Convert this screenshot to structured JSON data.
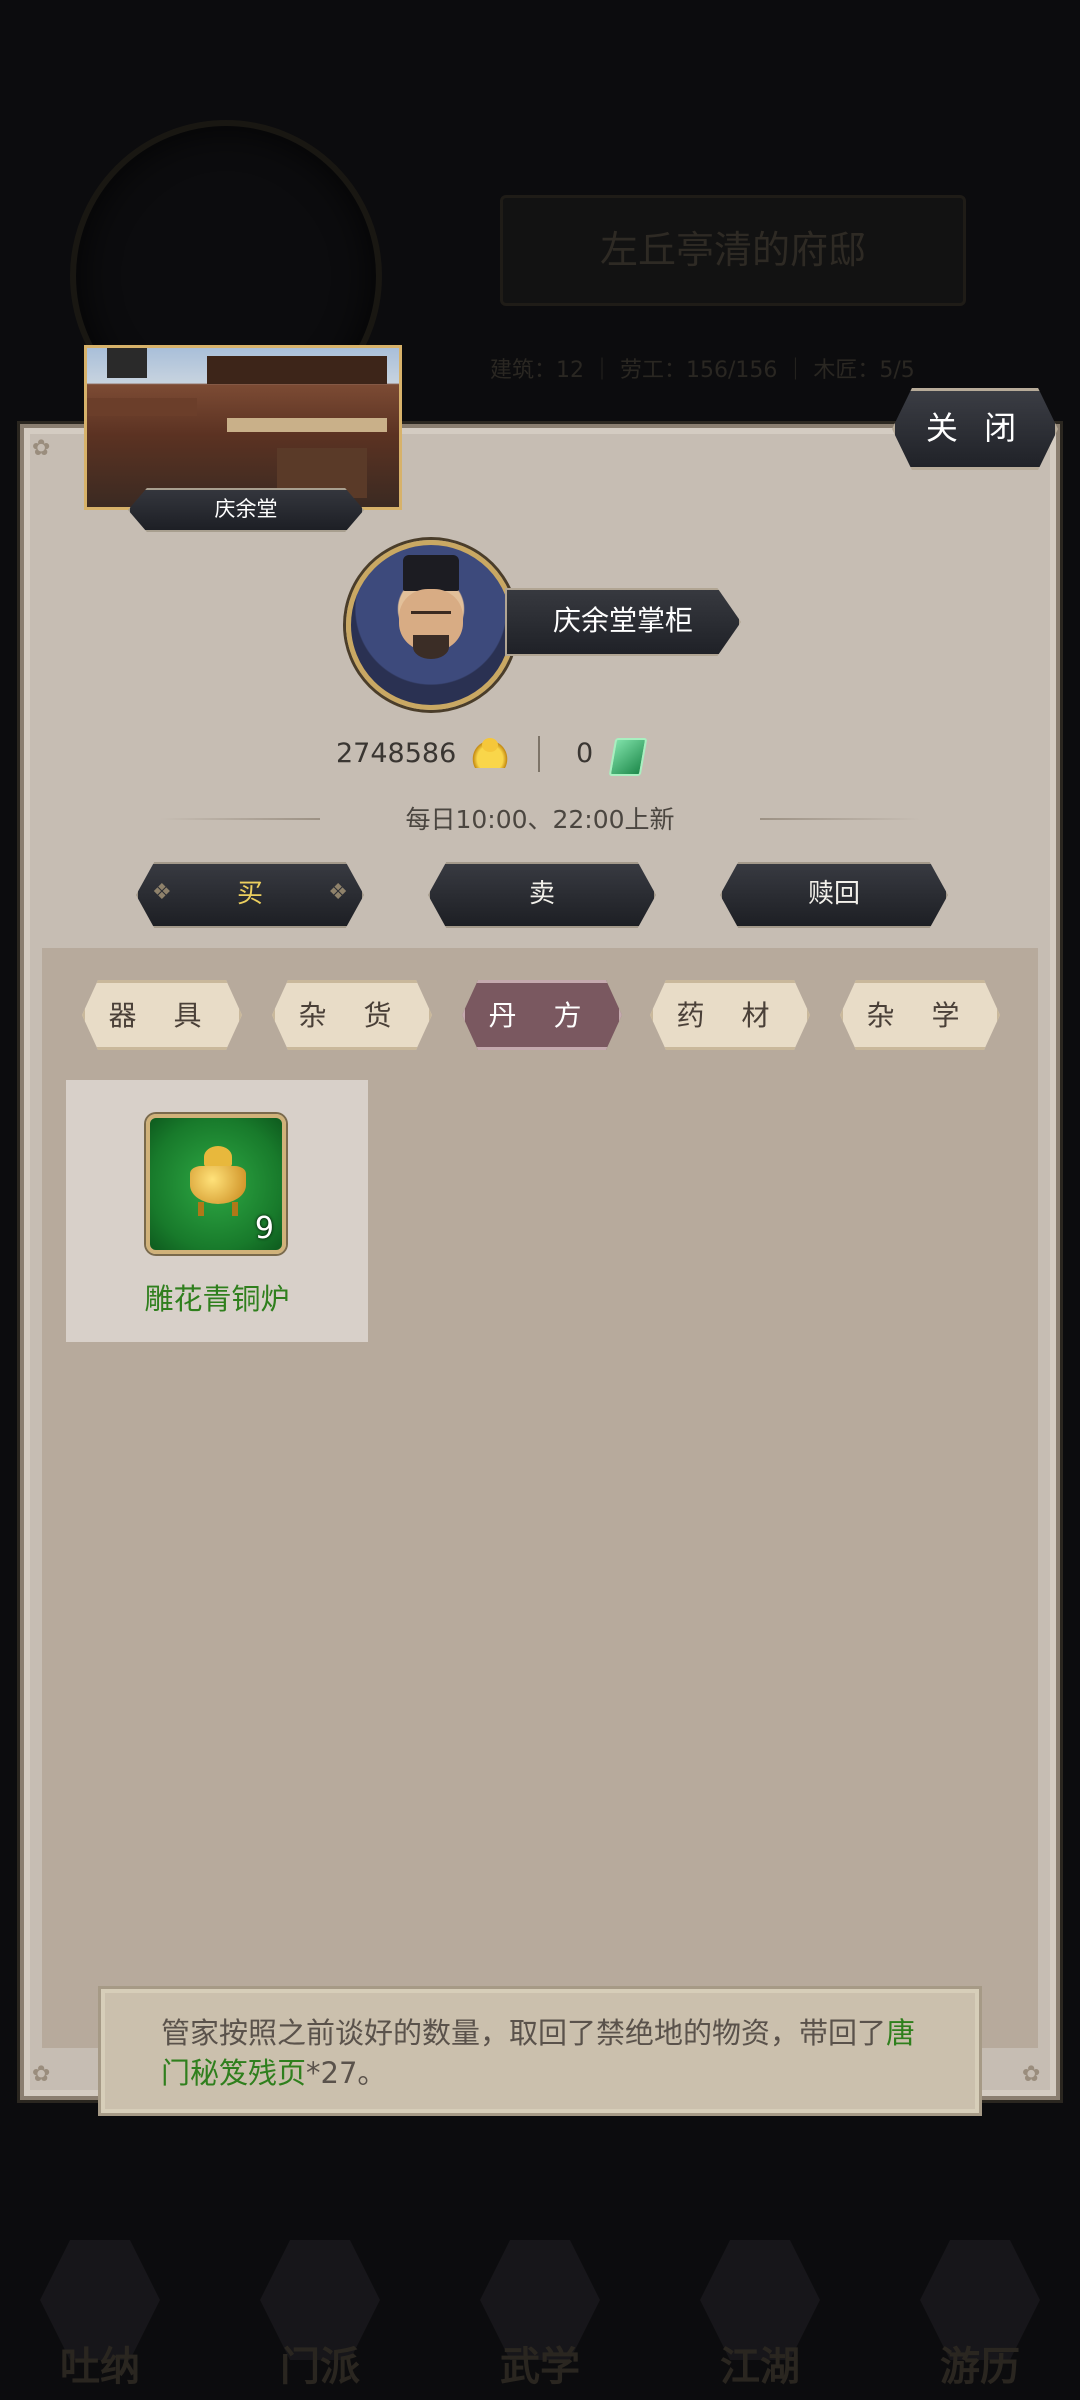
{
  "background": {
    "mansion_title": "左丘亭清的府邸",
    "stats": "建筑：12 ｜ 劳工：156/156 ｜ 木匠：5/5"
  },
  "modal": {
    "close_label": "关 闭",
    "shop_name": "庆余堂",
    "owner_title": "庆余堂掌柜",
    "gold_amount": "2748586",
    "gold_icon": "gold-ingot-icon",
    "jade_amount": "0",
    "jade_icon": "jade-token-icon",
    "refresh_note": "每日10:00、22:00上新",
    "actions": {
      "buy": "买",
      "sell": "卖",
      "redeem": "赎回",
      "active": "buy"
    },
    "categories": [
      {
        "label": "器 具",
        "active": false
      },
      {
        "label": "杂 货",
        "active": false
      },
      {
        "label": "丹 方",
        "active": true
      },
      {
        "label": "药 材",
        "active": false
      },
      {
        "label": "杂 学",
        "active": false
      }
    ],
    "items": [
      {
        "name": "雕花青铜炉",
        "count": "9",
        "icon": "bronze-censer-icon",
        "rarity_color": "#2ea844"
      }
    ]
  },
  "toast": {
    "text_before": "管家按照之前谈好的数量，取回了禁绝地的物资，带回了",
    "highlight": "唐门秘笈残页",
    "text_after": "*27。"
  },
  "bottom_nav": [
    {
      "label": "吐纳"
    },
    {
      "label": "门派"
    },
    {
      "label": "武学"
    },
    {
      "label": "江湖"
    },
    {
      "label": "游历"
    }
  ],
  "colors": {
    "accent_gold": "#eccf5f",
    "item_green": "#2f7f1d",
    "active_tab": "#7a5860"
  }
}
